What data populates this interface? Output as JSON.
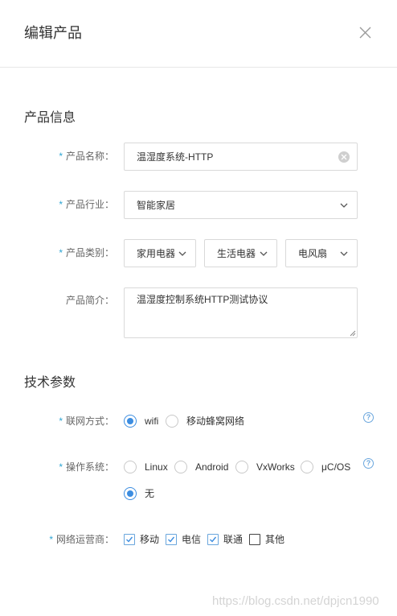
{
  "dialog": {
    "title": "编辑产品",
    "close_icon": "close-icon"
  },
  "sections": {
    "product_info": "产品信息",
    "tech_params": "技术参数"
  },
  "fields": {
    "name": {
      "label": "产品名称：",
      "required": true,
      "value": "温湿度系统-HTTP"
    },
    "industry": {
      "label": "产品行业：",
      "required": true,
      "value": "智能家居"
    },
    "category": {
      "label": "产品类别：",
      "required": true,
      "level1": "家用电器",
      "level2": "生活电器",
      "level3": "电风扇"
    },
    "intro": {
      "label": "产品简介：",
      "required": false,
      "value": "温湿度控制系统HTTP测试协议"
    },
    "network": {
      "label": "联网方式：",
      "required": true,
      "options": [
        "wifi",
        "移动蜂窝网络"
      ],
      "selected": "wifi"
    },
    "os": {
      "label": "操作系统：",
      "required": true,
      "options": [
        "Linux",
        "Android",
        "VxWorks",
        "μC/OS",
        "无"
      ],
      "selected": "无"
    },
    "carrier": {
      "label": "网络运营商：",
      "required": true,
      "options": [
        "移动",
        "电信",
        "联通",
        "其他"
      ],
      "checked": [
        "移动",
        "电信",
        "联通"
      ]
    }
  },
  "required_mark": "*",
  "help_mark": "?",
  "watermark": "https://blog.csdn.net/dpjcn1990",
  "colors": {
    "accent": "#3c8de0",
    "required": "#2fa5d3",
    "border": "#d9d9d9",
    "watermark": "#d4d4d4"
  }
}
